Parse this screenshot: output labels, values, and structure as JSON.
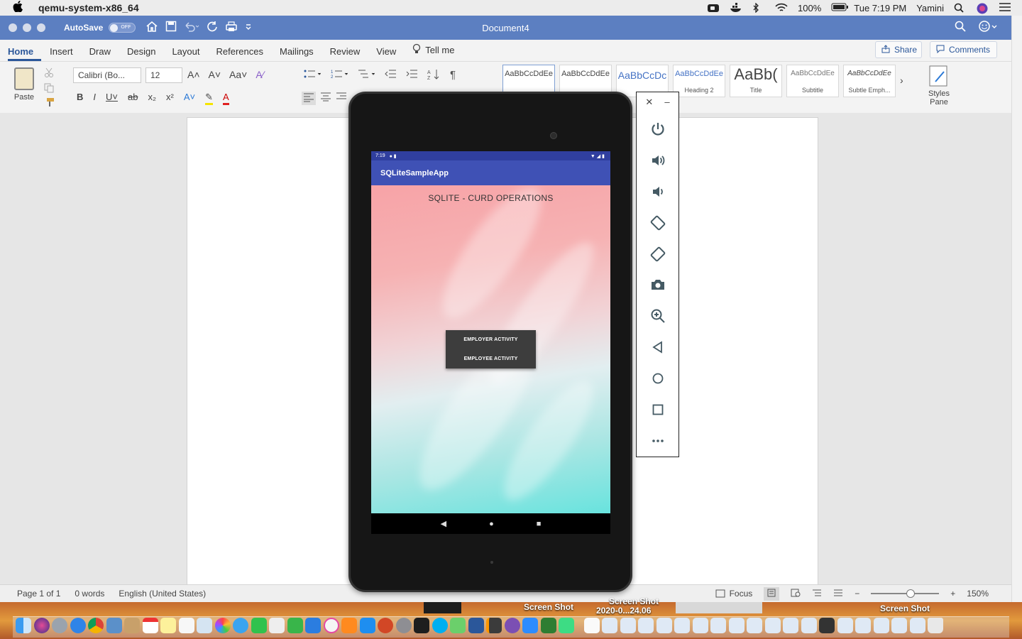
{
  "menubar": {
    "apple": "",
    "app_name": "qemu-system-x86_64",
    "battery": "100%",
    "clock": "Tue 7:19 PM",
    "user": "Yamini"
  },
  "word": {
    "autosave_label": "AutoSave",
    "autosave_state": "OFF",
    "doc_title": "Document4",
    "tabs": [
      "Home",
      "Insert",
      "Draw",
      "Design",
      "Layout",
      "References",
      "Mailings",
      "Review",
      "View"
    ],
    "tell_me": "Tell me",
    "share": "Share",
    "comments": "Comments",
    "paste": "Paste",
    "font_name": "Calibri (Bo...",
    "font_size": "12",
    "styles": [
      {
        "sample": "AaBbCcDdEe",
        "name": ""
      },
      {
        "sample": "AaBbCcDdEe",
        "name": ""
      },
      {
        "sample": "AaBbCcDc",
        "name": ""
      },
      {
        "sample": "AaBbCcDdEe",
        "name": "Heading 2"
      },
      {
        "sample": "AaBb(",
        "name": "Title"
      },
      {
        "sample": "AaBbCcDdEe",
        "name": "Subtitle"
      },
      {
        "sample": "AaBbCcDdEe",
        "name": "Subtle Emph..."
      }
    ],
    "styles_pane": "Styles Pane",
    "status": {
      "page": "Page 1 of 1",
      "words": "0 words",
      "language": "English (United States)",
      "focus": "Focus",
      "zoom": "150%"
    }
  },
  "emulator": {
    "time": "7:19",
    "app_title": "SQLiteSampleApp",
    "headline": "SQLITE - CURD OPERATIONS",
    "menu": [
      "EMPLOYER ACTIVITY",
      "EMPLOYEE ACTIVITY"
    ],
    "toolbar_buttons": [
      "power",
      "volume-up",
      "volume-down",
      "rotate-left",
      "rotate-right",
      "screenshot",
      "zoom",
      "back",
      "home",
      "overview",
      "more"
    ]
  },
  "dock": {
    "labels": [
      "Screen Shot",
      "Screen Shot",
      "2020-0...24.06",
      "Screen Shot"
    ]
  }
}
